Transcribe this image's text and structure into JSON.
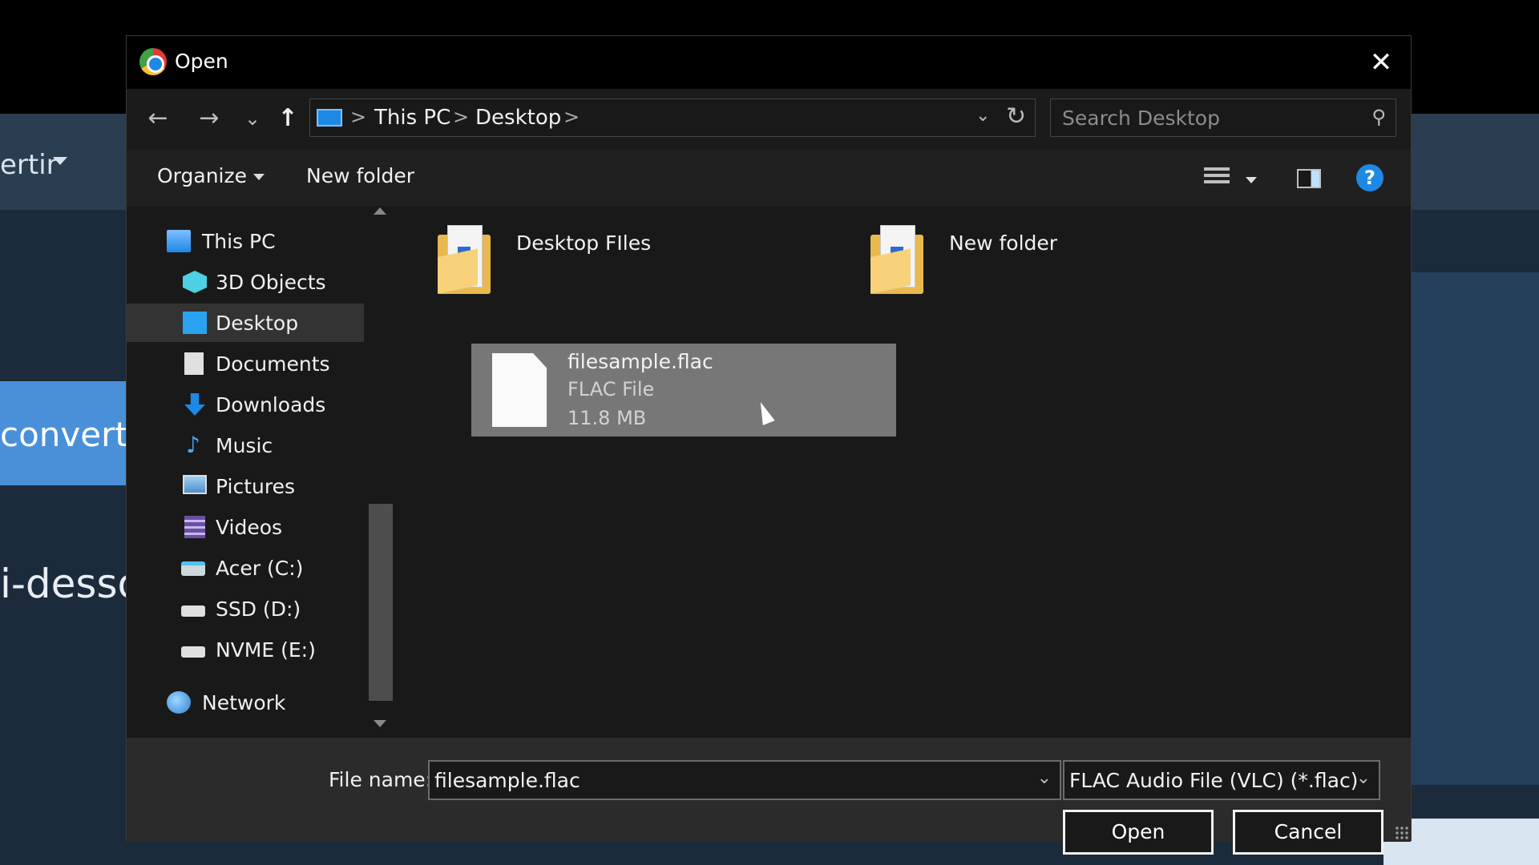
{
  "background": {
    "nav_text": "ertir",
    "convert_text": "convertir",
    "dessous_text": "i-dessou"
  },
  "dialog": {
    "title": "Open",
    "close_symbol": "✕"
  },
  "navigation": {
    "back_symbol": "←",
    "forward_symbol": "→",
    "recent_symbol": "⌄",
    "up_symbol": "↑",
    "breadcrumbs": [
      "This PC",
      "Desktop"
    ],
    "separator": ">",
    "address_dropdown_symbol": "⌄",
    "refresh_symbol": "↻",
    "search_placeholder": "Search Desktop",
    "search_symbol": "⚲"
  },
  "toolbar": {
    "organize_label": "Organize",
    "new_folder_label": "New folder",
    "help_symbol": "?"
  },
  "sidebar": {
    "items": [
      {
        "label": "This PC",
        "icon": "this-pc-icon"
      },
      {
        "label": "3D Objects",
        "icon": "3d-objects-icon"
      },
      {
        "label": "Desktop",
        "icon": "desktop-icon",
        "selected": true
      },
      {
        "label": "Documents",
        "icon": "documents-icon"
      },
      {
        "label": "Downloads",
        "icon": "downloads-icon"
      },
      {
        "label": "Music",
        "icon": "music-icon"
      },
      {
        "label": "Pictures",
        "icon": "pictures-icon"
      },
      {
        "label": "Videos",
        "icon": "videos-icon"
      },
      {
        "label": "Acer (C:)",
        "icon": "drive-icon"
      },
      {
        "label": "SSD (D:)",
        "icon": "drive-icon"
      },
      {
        "label": "NVME (E:)",
        "icon": "drive-icon"
      },
      {
        "label": "Network",
        "icon": "network-icon"
      }
    ]
  },
  "files": [
    {
      "name": "Desktop FIles",
      "type": "folder"
    },
    {
      "name": "New folder",
      "type": "folder"
    },
    {
      "name": "filesample.flac",
      "kind": "FLAC File",
      "size": "11.8 MB",
      "type": "file",
      "selected": true
    }
  ],
  "footer": {
    "file_name_label": "File name:",
    "file_name_value": "filesample.flac",
    "file_type_value": "FLAC Audio File (VLC) (*.flac)",
    "dropdown_symbol": "⌄",
    "open_label": "Open",
    "cancel_label": "Cancel"
  },
  "colors": {
    "accent": "#1e88e5",
    "selection": "#777777",
    "dialog_bg": "#191919"
  }
}
